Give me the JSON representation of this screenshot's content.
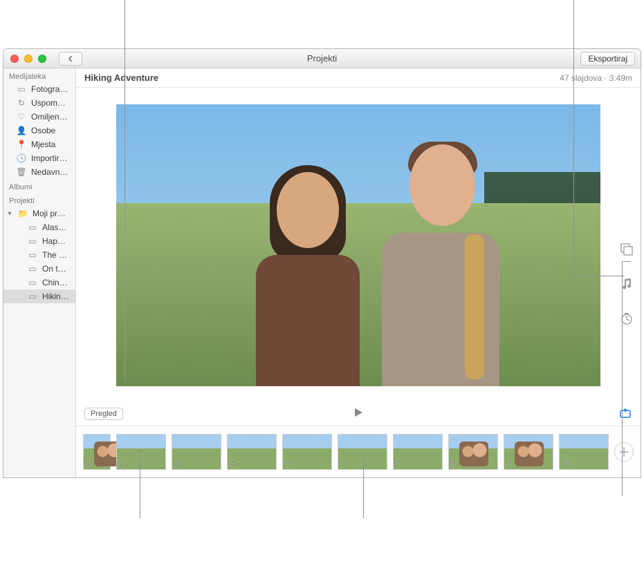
{
  "window": {
    "title": "Projekti",
    "export_label": "Eksportiraj"
  },
  "sidebar": {
    "sections": {
      "library": "Medijateka",
      "albums": "Albumi",
      "projects": "Projekti"
    },
    "library_items": [
      {
        "icon": "photos",
        "label": "Fotografije"
      },
      {
        "icon": "memories",
        "label": "Uspomene"
      },
      {
        "icon": "favorites",
        "label": "Omiljene stavke"
      },
      {
        "icon": "people",
        "label": "Osobe"
      },
      {
        "icon": "places",
        "label": "Mjesta"
      },
      {
        "icon": "imports",
        "label": "Importirane stavke"
      },
      {
        "icon": "trash",
        "label": "Nedavno obrisano"
      }
    ],
    "projects_root": "Moji projekti",
    "project_items": [
      {
        "label": "Alaska Book Proj…"
      },
      {
        "label": "Happy Birthday…"
      },
      {
        "label": "The Pup"
      },
      {
        "label": "On top of the W…"
      },
      {
        "label": "Chinese New Year"
      },
      {
        "label": "Hiking Adventure",
        "selected": true
      }
    ]
  },
  "project": {
    "title": "Hiking Adventure",
    "meta": "47 slajdova · 3:49m"
  },
  "controls": {
    "preview_label": "Pregled"
  },
  "filmstrip": {
    "thumbs": [
      {
        "n": "1"
      },
      {
        "n": "2"
      },
      {
        "n": "3"
      },
      {
        "n": "4"
      },
      {
        "n": "5"
      },
      {
        "n": "6"
      },
      {
        "n": "7"
      },
      {
        "n": "8"
      },
      {
        "n": "9"
      },
      {
        "n": "10"
      }
    ]
  }
}
